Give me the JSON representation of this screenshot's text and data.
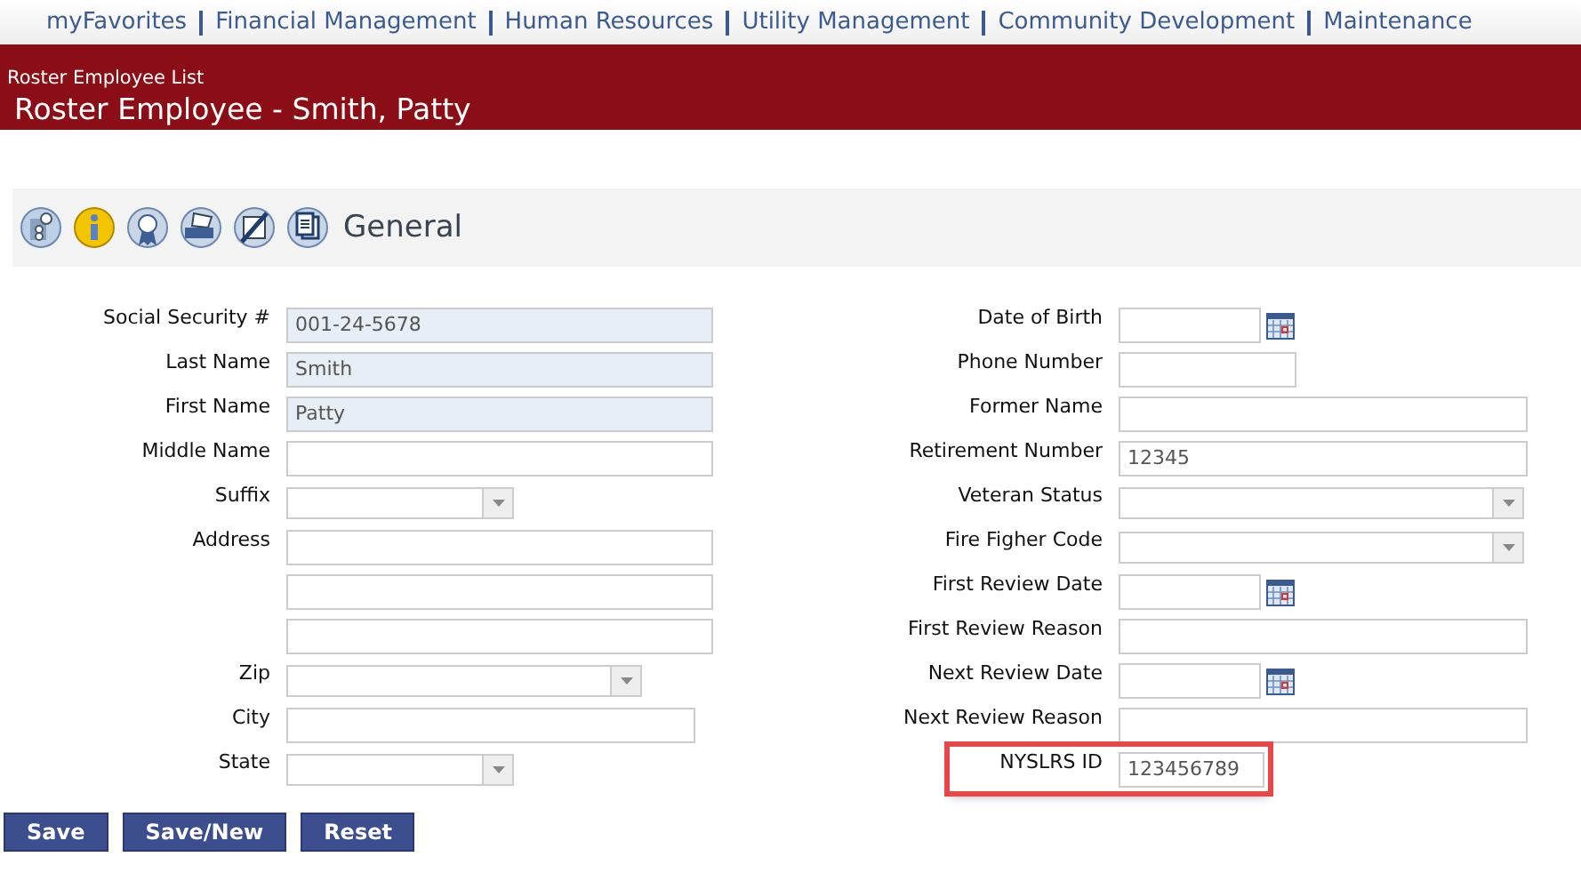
{
  "nav": [
    {
      "label": "myFavorites"
    },
    {
      "label": "Financial Management"
    },
    {
      "label": "Human Resources"
    },
    {
      "label": "Utility Management"
    },
    {
      "label": "Community Development"
    },
    {
      "label": "Maintenance"
    }
  ],
  "header": {
    "breadcrumb": "Roster Employee List",
    "title": "Roster Employee - Smith, Patty"
  },
  "toolbar": {
    "section": "General"
  },
  "left_fields": [
    {
      "label": "Social Security #",
      "kind": "text",
      "value": "001-24-5678",
      "disabled": true
    },
    {
      "label": "Last Name",
      "kind": "text",
      "value": "Smith",
      "disabled": true
    },
    {
      "label": "First Name",
      "kind": "text",
      "value": "Patty",
      "disabled": true
    },
    {
      "label": "Middle Name",
      "kind": "text",
      "disabled": false
    },
    {
      "label": "Suffix",
      "kind": "select",
      "disabled": false
    },
    {
      "label": "Address",
      "kind": "text",
      "disabled": false
    },
    {
      "kind": "text",
      "disabled": false
    },
    {
      "kind": "text",
      "disabled": false
    },
    {
      "label": "Zip",
      "kind": "select",
      "disabled": false
    },
    {
      "label": "City",
      "kind": "text",
      "disabled": false
    },
    {
      "label": "State",
      "kind": "select",
      "disabled": false
    }
  ],
  "right_fields": [
    {
      "label": "Date of Birth",
      "kind": "date",
      "highlighted": false
    },
    {
      "label": "Phone Number",
      "kind": "text",
      "highlighted": false
    },
    {
      "label": "Former Name",
      "kind": "text",
      "highlighted": false
    },
    {
      "label": "Retirement Number",
      "kind": "text",
      "value": "12345",
      "highlighted": false
    },
    {
      "label": "Veteran Status",
      "kind": "select",
      "highlighted": false
    },
    {
      "label": "Fire Figher Code",
      "kind": "select",
      "highlighted": false
    },
    {
      "label": "First Review Date",
      "kind": "date",
      "highlighted": false
    },
    {
      "label": "First Review Reason",
      "kind": "text",
      "highlighted": false
    },
    {
      "label": "Next Review Date",
      "kind": "date",
      "highlighted": false
    },
    {
      "label": "Next Review Reason",
      "kind": "text",
      "highlighted": false
    },
    {
      "label": "NYSLRS ID",
      "kind": "text",
      "value": "123456789",
      "highlighted": true
    }
  ],
  "buttons": [
    "Save",
    "Save/New",
    "Reset"
  ]
}
